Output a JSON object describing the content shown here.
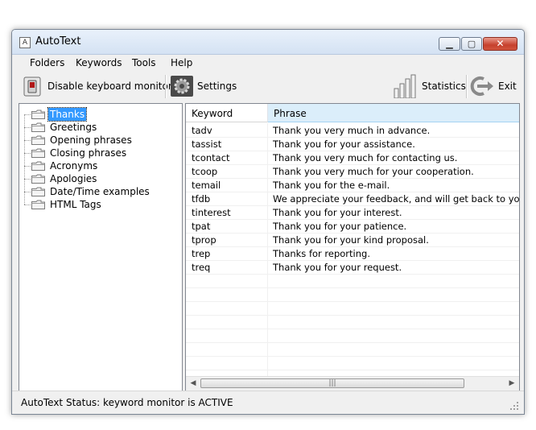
{
  "window": {
    "title": "AutoText",
    "app_icon_letter": "A",
    "controls": {
      "minimize": "▁",
      "maximize": "▢",
      "close": "✕"
    }
  },
  "menu": {
    "items": [
      "Folders",
      "Keywords",
      "Tools",
      "Help"
    ]
  },
  "toolbar": {
    "disable_monitor_label": "Disable keyboard monitor",
    "settings_label": "Settings",
    "statistics_label": "Statistics",
    "exit_label": "Exit",
    "icons": {
      "disable_monitor": "power-switch-icon",
      "settings": "gear-icon",
      "statistics": "bar-chart-icon",
      "exit": "exit-arrow-icon"
    }
  },
  "tree": {
    "folder_icon": "folder-icon",
    "selected_index": 0,
    "items": [
      "Thanks",
      "Greetings",
      "Opening phrases",
      "Closing phrases",
      "Acronyms",
      "Apologies",
      "Date/Time examples",
      "HTML Tags"
    ]
  },
  "list": {
    "columns": [
      "Keyword",
      "Phrase"
    ],
    "rows": [
      {
        "keyword": "tadv",
        "phrase": "Thank you very much in advance."
      },
      {
        "keyword": "tassist",
        "phrase": "Thank you for your assistance."
      },
      {
        "keyword": "tcontact",
        "phrase": "Thank you very much for contacting us."
      },
      {
        "keyword": "tcoop",
        "phrase": "Thank you very much for your cooperation."
      },
      {
        "keyword": "temail",
        "phrase": "Thank you for the e-mail."
      },
      {
        "keyword": "tfdb",
        "phrase": "We appreciate your feedback, and will get back to you as soon a"
      },
      {
        "keyword": "tinterest",
        "phrase": "Thank you for your interest."
      },
      {
        "keyword": "tpat",
        "phrase": "Thank you for your patience."
      },
      {
        "keyword": "tprop",
        "phrase": "Thank you for your kind proposal."
      },
      {
        "keyword": "trep",
        "phrase": "Thanks for reporting."
      },
      {
        "keyword": "treq",
        "phrase": "Thank you for your request."
      }
    ],
    "scrollbar": {
      "left_arrow": "◀",
      "right_arrow": "▶",
      "thumb_grip": "|||"
    }
  },
  "status": {
    "text": "AutoText Status: keyword monitor is ACTIVE"
  },
  "colors": {
    "selection": "#3399ff",
    "header_highlight": "#dbeefa",
    "close_button": "#c6402c"
  }
}
